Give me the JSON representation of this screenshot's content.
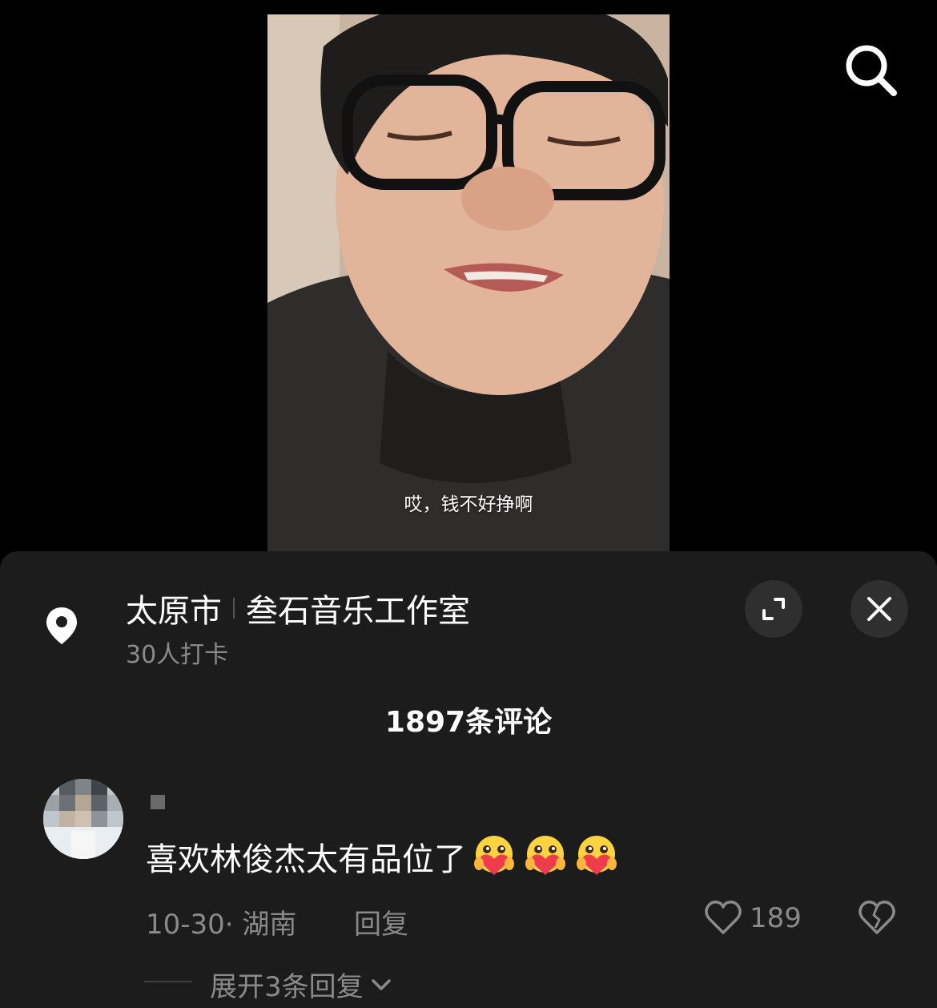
{
  "video": {
    "subtitle": "哎，钱不好挣啊"
  },
  "location": {
    "city": "太原市",
    "place": "叁石音乐工作室",
    "checkins": "30人打卡"
  },
  "comments_header": {
    "count_label": "1897条评论"
  },
  "comment": {
    "text": "喜欢林俊杰太有品位了",
    "emoji_name": "heart-hug-emoji",
    "time_location": "10-30· 湖南",
    "reply_label": "回复",
    "like_count": "189",
    "expand_replies_label": "展开3条回复"
  },
  "icons": {
    "search": "search-icon",
    "pin": "location-pin-icon",
    "expand": "expand-icon",
    "close": "close-icon",
    "like": "heart-icon",
    "dislike": "broken-heart-icon",
    "chevron": "chevron-down-icon"
  },
  "colors": {
    "sheet_bg": "#1c1c1c",
    "muted_text": "#8a8a8a",
    "button_bg": "#2f2f2f"
  }
}
